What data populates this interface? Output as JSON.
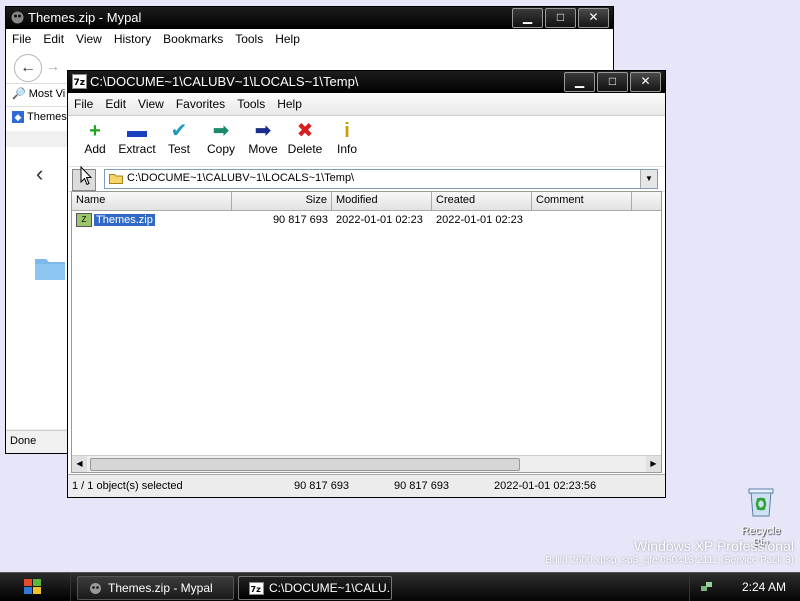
{
  "desktop": {
    "recycle_bin_label": "Recycle Bin",
    "watermark_title": "Windows XP Professional",
    "watermark_build": "Build 2600.xpsp_sp3_qfe.080413-2111 (Service Pack 3)"
  },
  "mypal": {
    "title": "Themes.zip - Mypal",
    "menu": [
      "File",
      "Edit",
      "View",
      "History",
      "Bookmarks",
      "Tools",
      "Help"
    ],
    "bookmark": "Most Vi",
    "tab_label": "Themes",
    "status": "Done",
    "caption": {
      "minimize": "▁",
      "maximize": "□",
      "close": "✕"
    }
  },
  "sevenzip": {
    "title": "C:\\DOCUME~1\\CALUBV~1\\LOCALS~1\\Temp\\",
    "menu": [
      "File",
      "Edit",
      "View",
      "Favorites",
      "Tools",
      "Help"
    ],
    "toolbar": [
      {
        "label": "Add",
        "icon": "+",
        "color": "#1fa51f"
      },
      {
        "label": "Extract",
        "icon": "▬",
        "color": "#1a3fbf"
      },
      {
        "label": "Test",
        "icon": "✔",
        "color": "#1a9cc0"
      },
      {
        "label": "Copy",
        "icon": "➡",
        "color": "#1a8a6a"
      },
      {
        "label": "Move",
        "icon": "➡",
        "color": "#1a2d8a"
      },
      {
        "label": "Delete",
        "icon": "✖",
        "color": "#d42020"
      },
      {
        "label": "Info",
        "icon": "i",
        "color": "#c9a000"
      }
    ],
    "address": "C:\\DOCUME~1\\CALUBV~1\\LOCALS~1\\Temp\\",
    "columns": {
      "name": "Name",
      "size": "Size",
      "modified": "Modified",
      "created": "Created",
      "comment": "Comment"
    },
    "rows": [
      {
        "name": "Themes.zip",
        "size": "90 817 693",
        "modified": "2022-01-01 02:23",
        "created": "2022-01-01 02:23",
        "comment": ""
      }
    ],
    "status": {
      "selected": "1 / 1 object(s) selected",
      "size": "90 817 693",
      "packed": "90 817 693",
      "date": "2022-01-01 02:23:56"
    },
    "caption": {
      "minimize": "▁",
      "maximize": "□",
      "close": "✕"
    }
  },
  "taskbar": {
    "tasks": [
      "Themes.zip - Mypal",
      "C:\\DOCUME~1\\CALU..."
    ],
    "clock": "2:24 AM"
  }
}
